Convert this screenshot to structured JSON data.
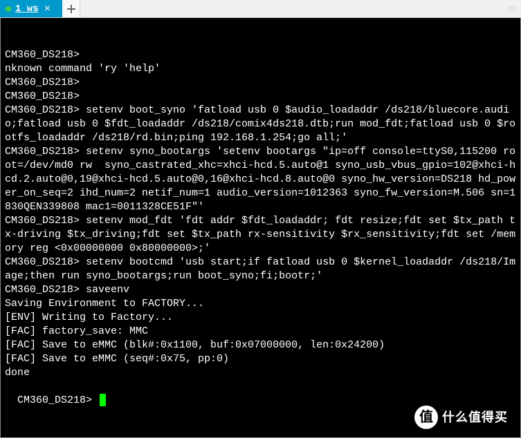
{
  "tab": {
    "label": "1 ws",
    "close_glyph": "×"
  },
  "nav": {
    "prev": "◁",
    "next": "▷"
  },
  "terminal": {
    "lines": [
      "CM360_DS218>",
      "nknown command 'ry 'help'",
      "CM360_DS218>",
      "CM360_DS218>",
      "CM360_DS218> setenv boot_syno 'fatload usb 0 $audio_loadaddr /ds218/bluecore.audio;fatload usb 0 $fdt_loadaddr /ds218/comix4ds218.dtb;run mod_fdt;fatload usb 0 $rootfs_loadaddr /ds218/rd.bin;ping 192.168.1.254;go all;'",
      "CM360_DS218> setenv syno_bootargs 'setenv bootargs \"ip=off console=ttyS0,115200 root=/dev/md0 rw  syno_castrated_xhc=xhci-hcd.5.auto@1 syno_usb_vbus_gpio=102@xhci-hcd.2.auto@0,19@xhci-hcd.5.auto@0,16@xhci-hcd.8.auto@0 syno_hw_version=DS218 hd_power_on_seq=2 ihd_num=2 netif_num=1 audio_version=1012363 syno_fw_version=M.506 sn=1830QEN339808 mac1=0011328CE51F\"'",
      "CM360_DS218> setenv mod_fdt 'fdt addr $fdt_loadaddr; fdt resize;fdt set $tx_path tx-driving $tx_driving;fdt set $tx_path rx-sensitivity $rx_sensitivity;fdt set /memory reg <0x00000000 0x80000000>;'",
      "CM360_DS218> setenv bootcmd 'usb start;if fatload usb 0 $kernel_loadaddr /ds218/Image;then run syno_bootargs;run boot_syno;fi;bootr;'",
      "CM360_DS218> saveenv",
      "Saving Environment to FACTORY...",
      "[ENV] Writing to Factory...",
      "[FAC] factory_save: MMC",
      "[FAC] Save to eMMC (blk#:0x1100, buf:0x07000000, len:0x24200)",
      "[FAC] Save to eMMC (seq#:0x75, pp:0)",
      "done"
    ],
    "final_prompt": "CM360_DS218> "
  },
  "watermark": {
    "circle_text": "值",
    "brand_text": "什么值得买"
  }
}
